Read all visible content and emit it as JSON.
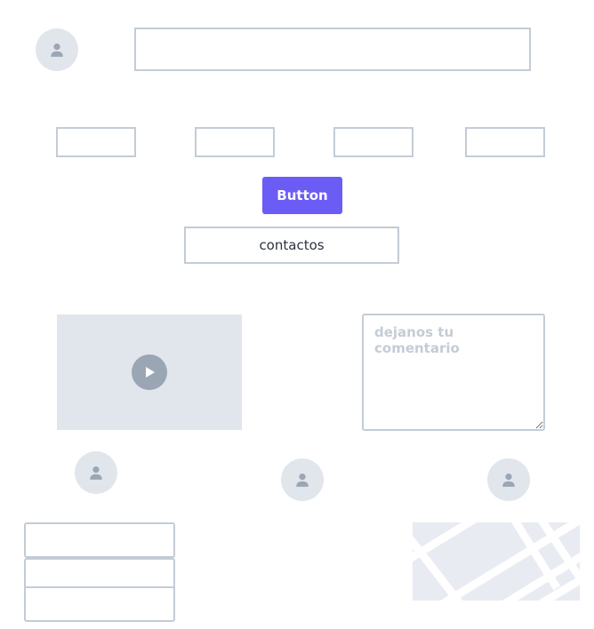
{
  "icons": {
    "avatar": "user-icon",
    "video": "play-icon",
    "map": "map-streets"
  },
  "colors": {
    "primary": "#6c5cf6",
    "border": "#c3ccd6",
    "placeholder_bg": "#e1e5ec",
    "placeholder_icon": "#9aa6b4"
  },
  "header": {
    "input_value": ""
  },
  "row_inputs": [
    "",
    "",
    "",
    ""
  ],
  "primary_button": {
    "label": "Button"
  },
  "contact_field": {
    "value": "contactos"
  },
  "comment": {
    "placeholder": "dejanos tu comentario",
    "value": ""
  },
  "stack_inputs": [
    "",
    "",
    ""
  ]
}
